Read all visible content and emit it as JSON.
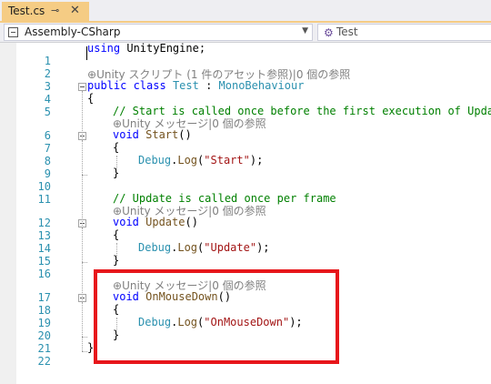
{
  "tab": {
    "filename": "Test.cs",
    "pin_glyph": "⊸",
    "close_glyph": "✕"
  },
  "navbar": {
    "project": "Assembly-CSharp",
    "class_name": "Test"
  },
  "editor": {
    "line_numbers": [
      "1",
      "2",
      "3",
      "4",
      "5",
      "6",
      "7",
      "8",
      "9",
      "10",
      "11",
      "12",
      "13",
      "14",
      "15",
      "16",
      "17",
      "18",
      "19",
      "20",
      "21",
      "22"
    ],
    "line1": {
      "kw": "using",
      "rest": " UnityEngine;"
    },
    "lens_class": "Unity スクリプト (1 件のアセット参照)|0 個の参照",
    "line3": {
      "kw1": "public",
      "kw2": " class",
      "name": " Test",
      "colon": " : ",
      "base": "MonoBehaviour"
    },
    "line4": "{",
    "line5_comment": "// Start is called once before the first execution of Update",
    "lens_start": "Unity メッセージ|0 個の参照",
    "line6": {
      "kw": "void",
      "name": " Start",
      "parens": "()"
    },
    "line7": "{",
    "line8": {
      "type": "Debug",
      "dot": ".",
      "method": "Log",
      "open": "(",
      "str": "\"Start\"",
      "close": ");"
    },
    "line9": "}",
    "line11_comment": "// Update is called once per frame",
    "lens_update": "Unity メッセージ|0 個の参照",
    "line12": {
      "kw": "void",
      "name": " Update",
      "parens": "()"
    },
    "line13": "{",
    "line14": {
      "type": "Debug",
      "dot": ".",
      "method": "Log",
      "open": "(",
      "str": "\"Update\"",
      "close": ");"
    },
    "line15": "}",
    "lens_mouse": "Unity メッセージ|0 個の参照",
    "line17": {
      "kw": "void",
      "name": " OnMouseDown",
      "parens": "()"
    },
    "line18": "{",
    "line19": {
      "type": "Debug",
      "dot": ".",
      "method": "Log",
      "open": "(",
      "str": "\"OnMouseDown\"",
      "close": ");"
    },
    "line20": "}",
    "line21": "}"
  },
  "colors": {
    "highlight_border": "#e7161b",
    "tab_active": "#f5cc84"
  }
}
